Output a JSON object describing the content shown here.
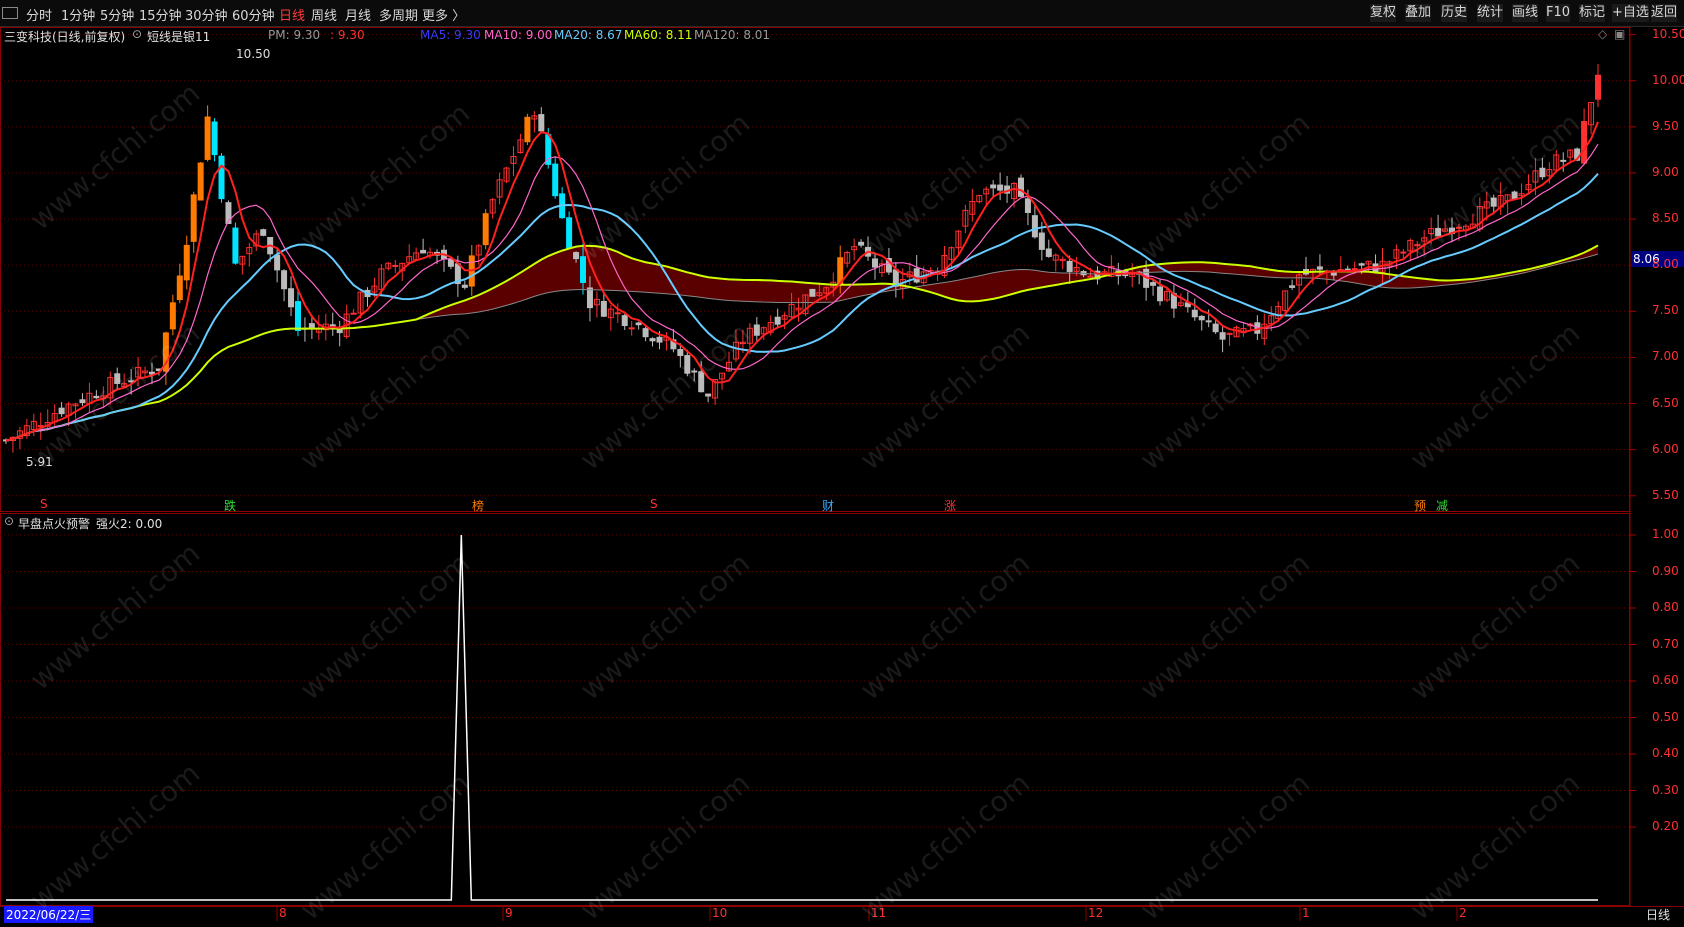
{
  "toolbar": {
    "periods": [
      "分时",
      "1分钟",
      "5分钟",
      "15分钟",
      "30分钟",
      "60分钟",
      "日线",
      "周线",
      "月线",
      "多周期",
      "更多 〉"
    ],
    "active_period": "日线",
    "right_buttons": [
      "复权",
      "叠加",
      "历史",
      "统计",
      "画线",
      "F10",
      "标记",
      "+自选",
      "返回"
    ]
  },
  "chart_header": {
    "stock": "三变科技(日线,前复权)",
    "indicator": "短线是银11",
    "pm_label": "PM: 9.30",
    "pm_value": ": 9.30",
    "ma5": "MA5: 9.30",
    "ma10": "MA10: 9.00",
    "ma20": "MA20: 8.67",
    "ma60": "MA60: 8.11",
    "ma120": "MA120: 8.01"
  },
  "sub_header": {
    "title": "早盘点火预警",
    "value": "强火2: 0.00"
  },
  "annotations": {
    "high": "10.50",
    "low": "5.91",
    "current": "8.06"
  },
  "signals": [
    "S",
    "跌",
    "榜",
    "S",
    "财",
    "涨",
    "预",
    "减"
  ],
  "watermark": "www.cfchi.com",
  "price_axis": [
    "10.50",
    "10.00",
    "9.50",
    "9.00",
    "8.50",
    "8.00",
    "7.50",
    "7.00",
    "6.50",
    "6.00",
    "5.50"
  ],
  "sub_axis": [
    "1.00",
    "0.90",
    "0.80",
    "0.70",
    "0.60",
    "0.50",
    "0.40",
    "0.30",
    "0.20"
  ],
  "date_axis": [
    "2022/06/22/三",
    "8",
    "9",
    "10",
    "11",
    "12",
    "1",
    "2",
    "日线"
  ],
  "colors": {
    "up": "#ff3030",
    "down": "#00e5ff",
    "ma5": "#ff2020",
    "ma10": "#ff66cc",
    "ma20": "#66ccff",
    "ma60": "#ccff00",
    "ma120": "#888888",
    "fill_red": "#6b0000",
    "fill_green": "#0b5a0b",
    "accent_blue": "#1a1aff",
    "axis": "#8b0000"
  },
  "chart_data": {
    "type": "candlestick",
    "y_range": [
      5.4,
      10.55
    ],
    "sub_y_range": [
      0,
      1.0
    ],
    "series_sub": {
      "name": "强火2",
      "peak_x_fraction": 0.286,
      "peak_value": 1.0,
      "base_value": 0.0
    }
  }
}
